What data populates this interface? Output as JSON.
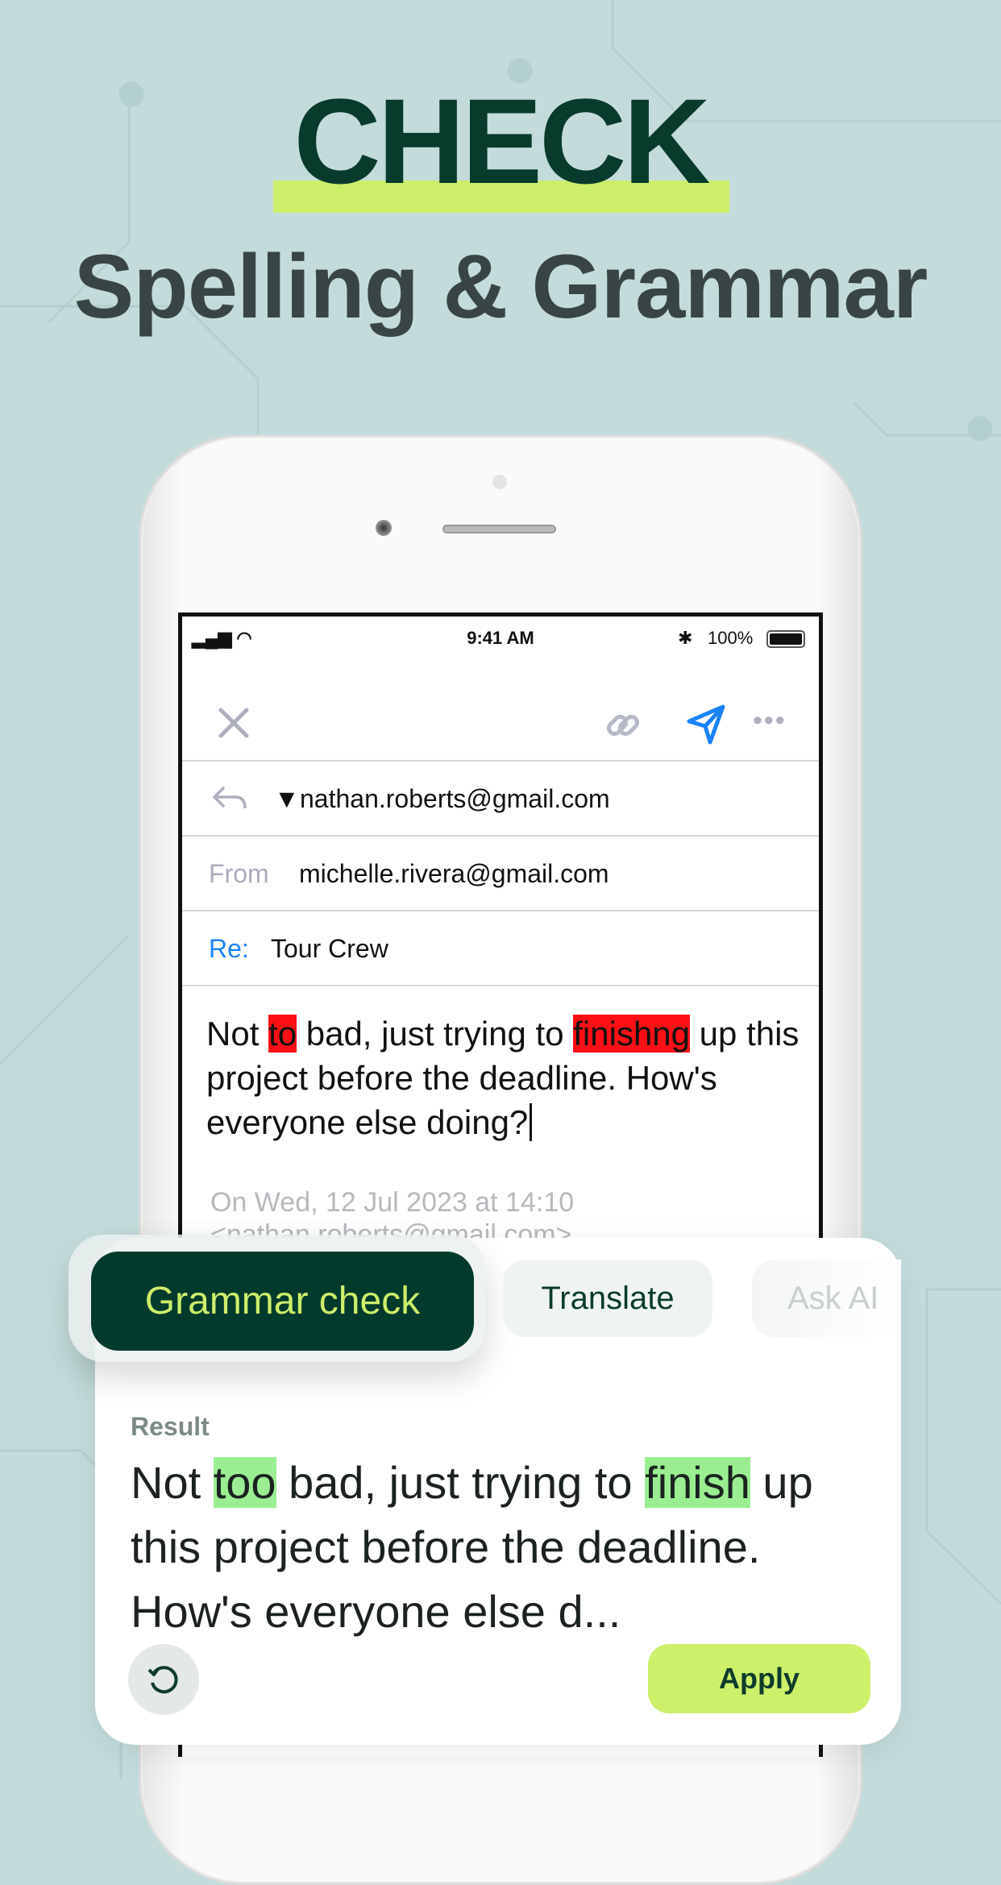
{
  "headline": {
    "title": "CHECK",
    "subtitle": "Spelling & Grammar"
  },
  "status_bar": {
    "time": "9:41 AM",
    "battery": "100%"
  },
  "email": {
    "to": "nathan.roberts@gmail.com",
    "from_label": "From",
    "from": "michelle.rivera@gmail.com",
    "subject_label": "Re:",
    "subject": "Tour Crew",
    "body": {
      "p1": "Not ",
      "e1": "to",
      "p2": " bad, just trying to ",
      "e2": "finishng",
      "p3": " up this project before the deadline. How's everyone else doing?"
    },
    "quote_line1": "On Wed, 12 Jul 2023 at 14:10",
    "quote_line2": "<nathan.roberts@gmail.com>"
  },
  "tools": {
    "tabs": [
      "Grammar check",
      "Translate",
      "Ask AI"
    ],
    "active": "Grammar check"
  },
  "result": {
    "label": "Result",
    "p1": "Not ",
    "c1": "too",
    "p2": " bad, just trying to ",
    "c2": "finish",
    "p3": " up this project before the deadline. How's everyone else d...",
    "apply": "Apply"
  },
  "colors": {
    "brand_dark": "#003b2c",
    "accent_lime": "#cdee6a",
    "error": "#fe0e15",
    "correction": "#9aee91",
    "link_blue": "#1a82fb"
  }
}
